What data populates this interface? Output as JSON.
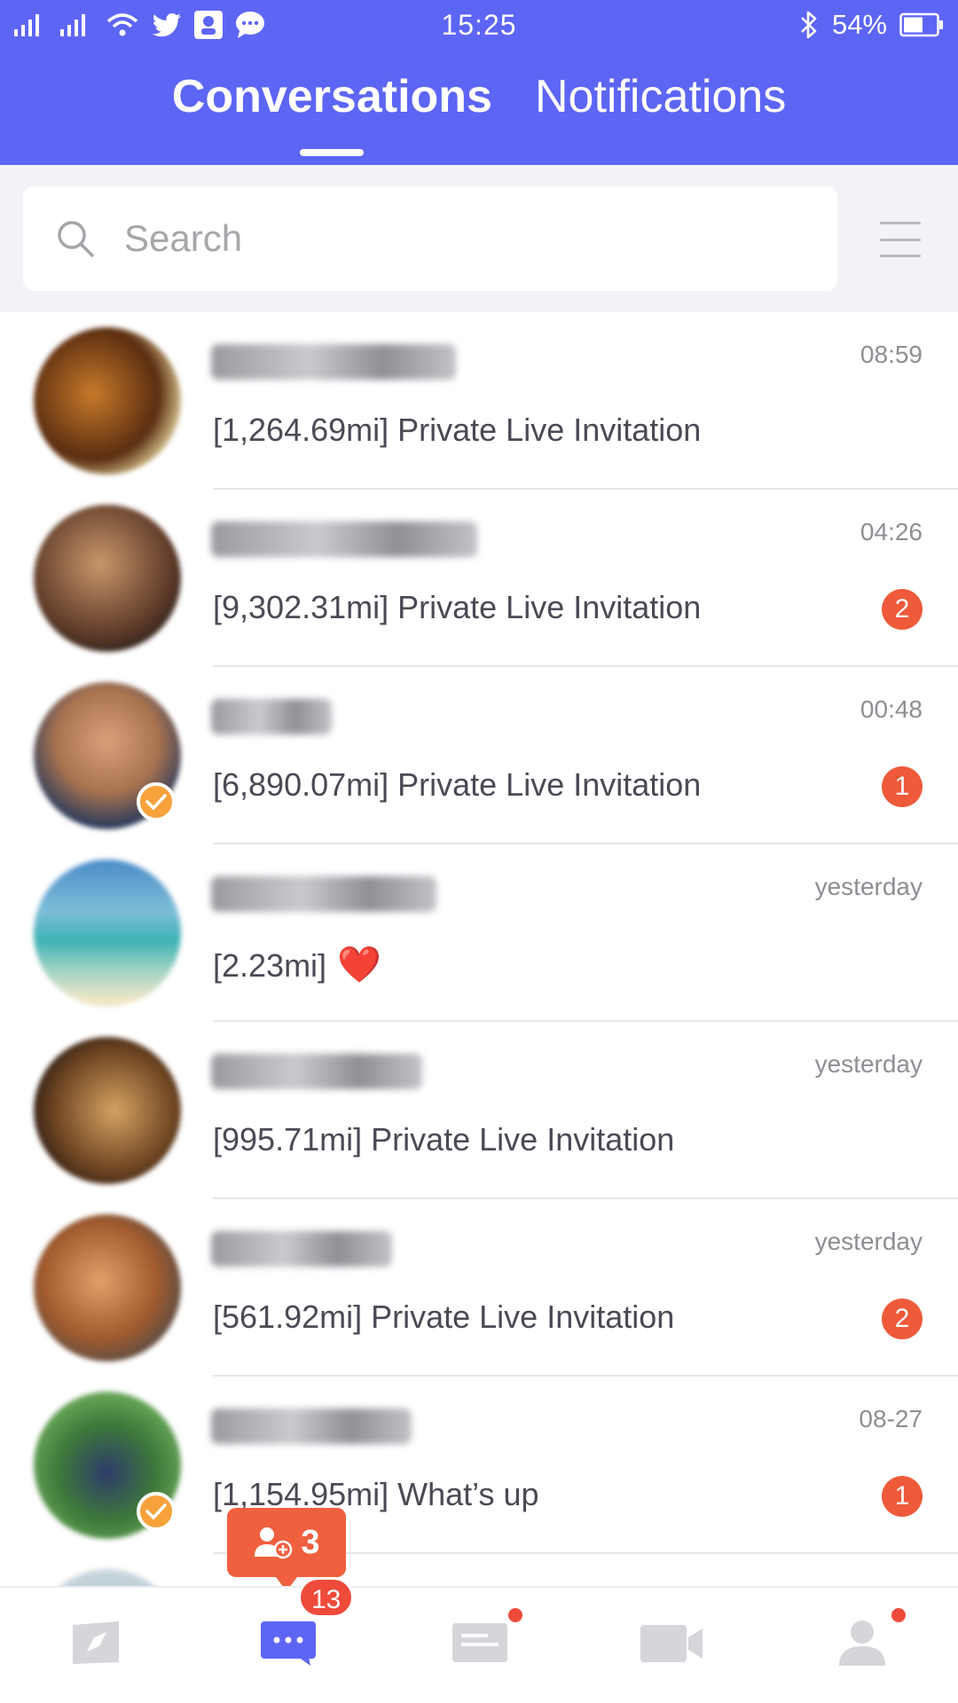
{
  "status_bar": {
    "time": "15:25",
    "battery_percent": "54%",
    "icons": [
      "signal-icon",
      "signal-icon",
      "wifi-icon",
      "twitter-icon",
      "app-icon",
      "chat-bubble-icon",
      "bluetooth-icon",
      "battery-icon"
    ]
  },
  "tabs": [
    {
      "label": "Conversations",
      "active": true
    },
    {
      "label": "Notifications",
      "active": false
    }
  ],
  "search": {
    "placeholder": "Search"
  },
  "conversations": [
    {
      "time": "08:59",
      "preview": "[1,264.69mi] Private Live Invitation",
      "unread": "",
      "verified": false
    },
    {
      "time": "04:26",
      "preview": "[9,302.31mi] Private Live Invitation",
      "unread": "2",
      "verified": false
    },
    {
      "time": "00:48",
      "preview": "[6,890.07mi] Private Live Invitation",
      "unread": "1",
      "verified": true
    },
    {
      "time": "yesterday",
      "preview": "[2.23mi]",
      "heart": "❤️",
      "unread": "",
      "verified": false
    },
    {
      "time": "yesterday",
      "preview": "[995.71mi] Private Live Invitation",
      "unread": "",
      "verified": false
    },
    {
      "time": "yesterday",
      "preview": "[561.92mi] Private Live Invitation",
      "unread": "2",
      "verified": false
    },
    {
      "time": "08-27",
      "preview": "[1,154.95mi] What’s up",
      "unread": "1",
      "verified": true
    }
  ],
  "friend_requests": {
    "count": "3"
  },
  "bottom_nav": {
    "messages_count": "13",
    "items": [
      "discover-icon",
      "messages-icon",
      "feed-icon",
      "video-icon",
      "profile-icon"
    ]
  },
  "colors": {
    "brand": "#5d65f5",
    "badge": "#ee5a3a",
    "verified": "#f7a23b"
  }
}
